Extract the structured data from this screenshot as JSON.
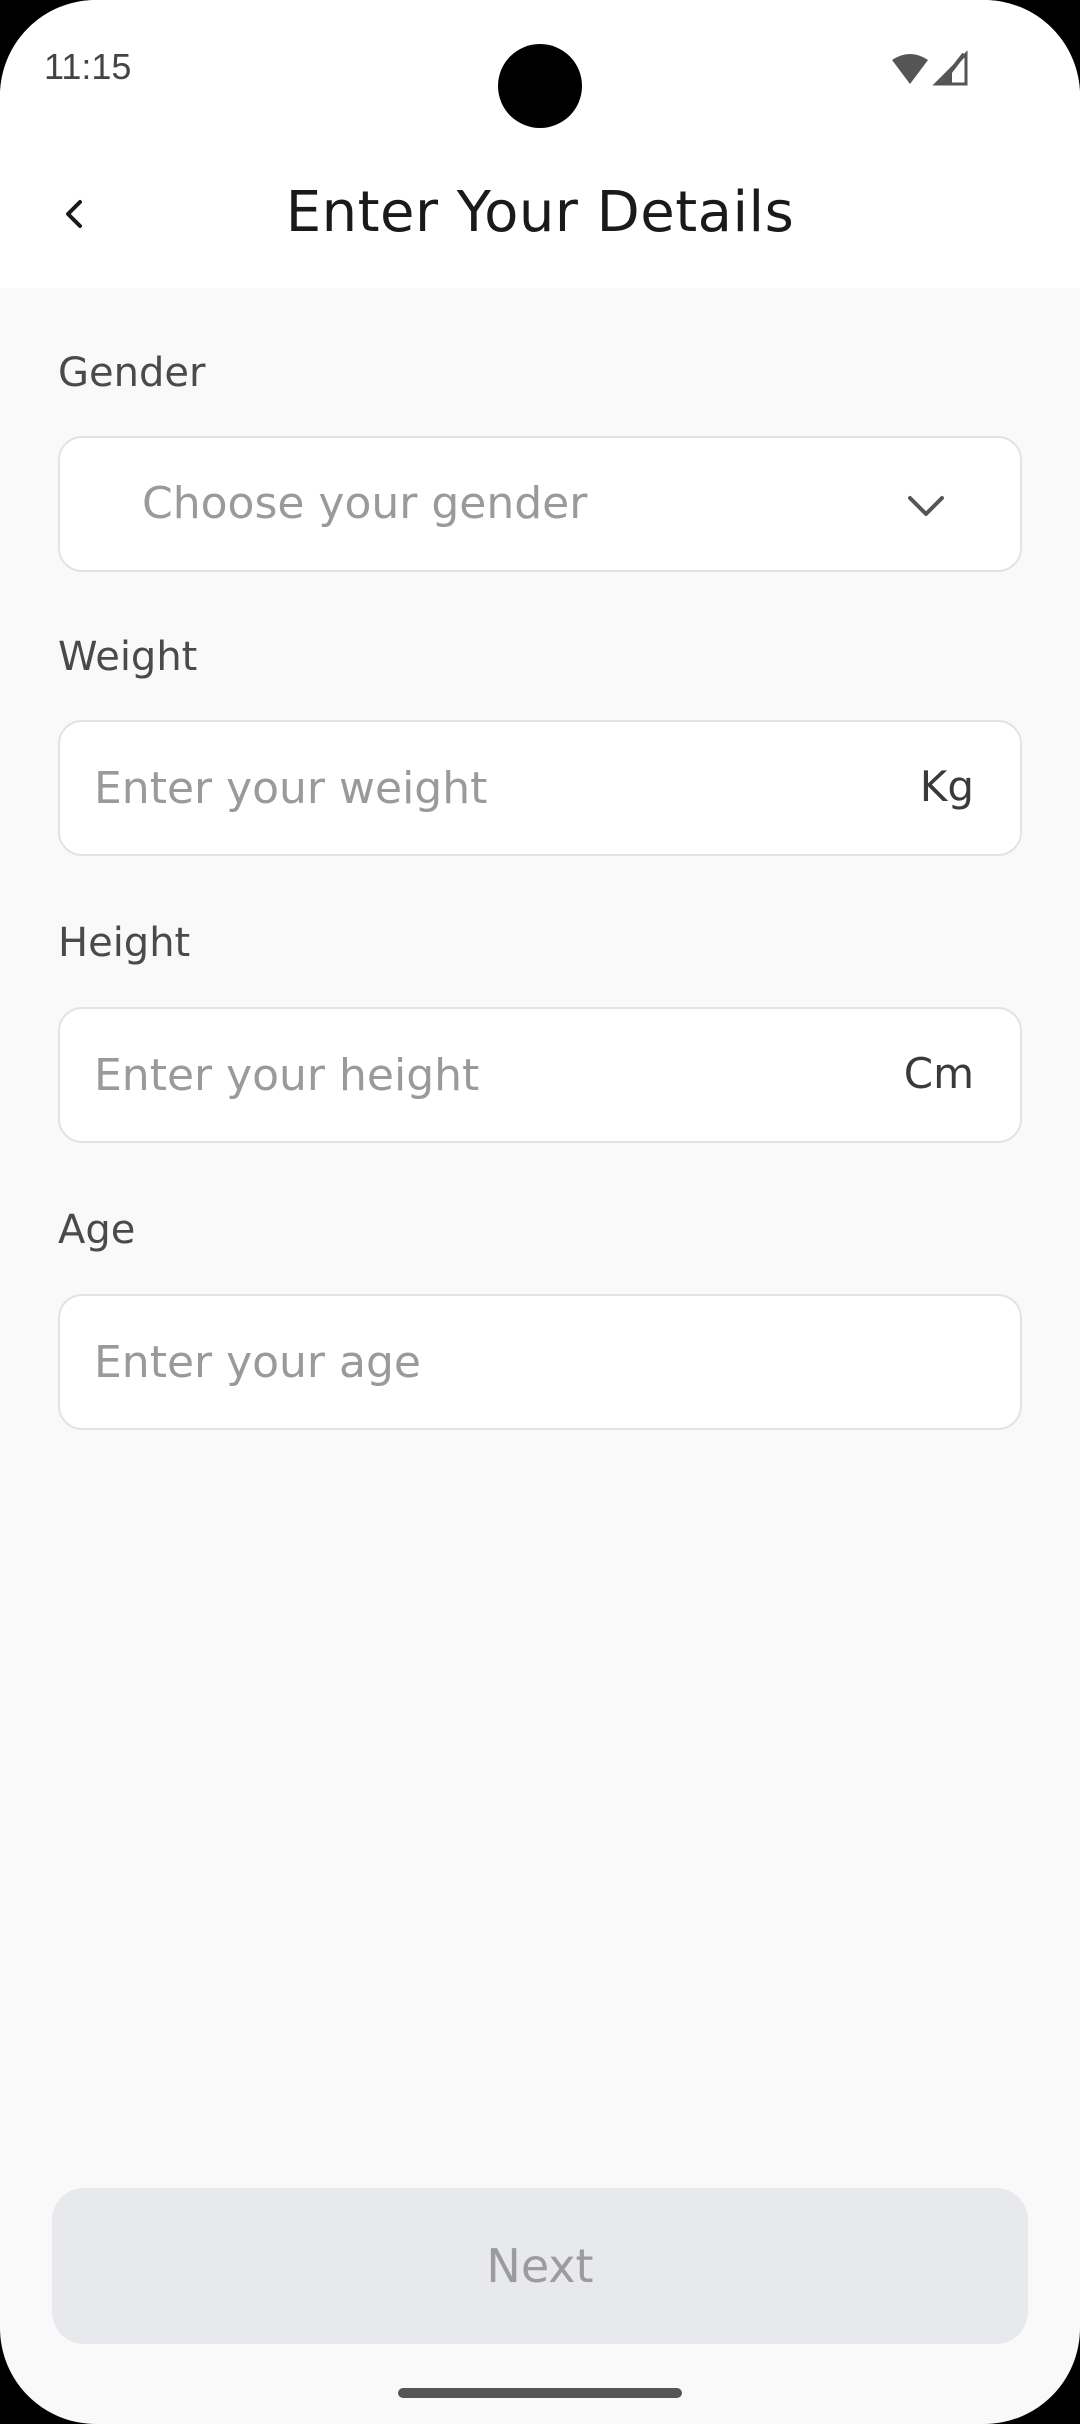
{
  "status_bar": {
    "time": "11:15"
  },
  "header": {
    "title": "Enter Your Details"
  },
  "form": {
    "gender": {
      "label": "Gender",
      "placeholder": "Choose your gender"
    },
    "weight": {
      "label": "Weight",
      "placeholder": "Enter your weight",
      "unit": "Kg"
    },
    "height": {
      "label": "Height",
      "placeholder": "Enter your height",
      "unit": "Cm"
    },
    "age": {
      "label": "Age",
      "placeholder": "Enter your age"
    }
  },
  "actions": {
    "next_label": "Next"
  },
  "icons": {
    "back": "back-arrow-icon",
    "dropdown": "chevron-down-icon",
    "wifi": "wifi-icon",
    "signal": "signal-icon"
  },
  "colors": {
    "background": "#f9f9f9",
    "surface": "#ffffff",
    "border": "#e3e3e3",
    "button_disabled_bg": "#e8e9ec",
    "button_disabled_text": "#9c9c9c"
  }
}
